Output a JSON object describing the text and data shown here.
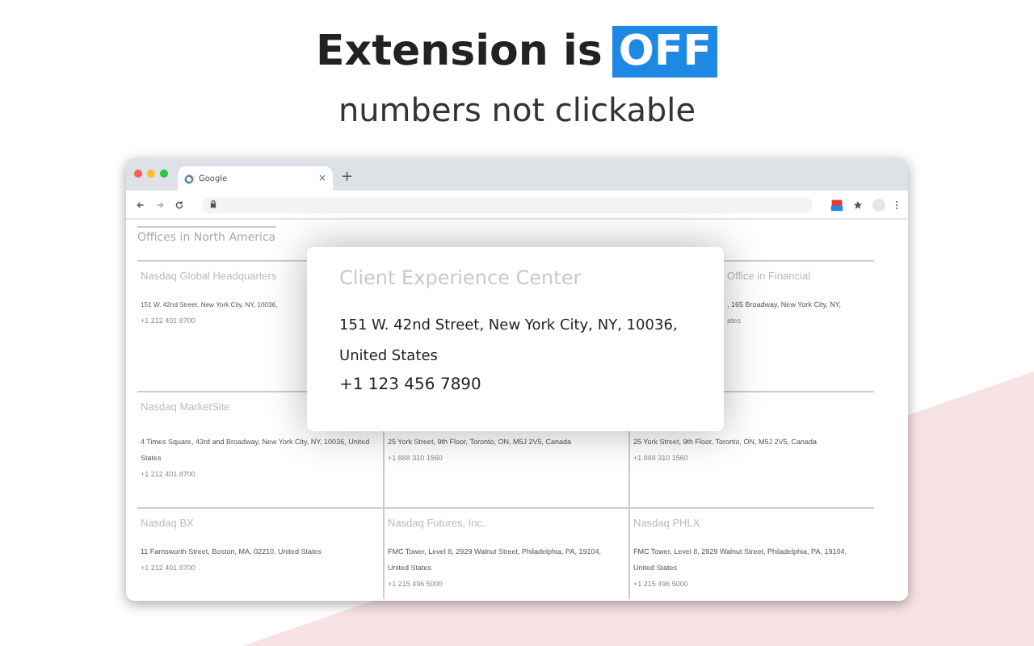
{
  "headline": {
    "text": "Extension is",
    "badge": "OFF"
  },
  "subtitle": "numbers not clickable",
  "browser": {
    "tab_title": "Google",
    "tab_close": "×",
    "new_tab": "+",
    "page": {
      "heading": "Offices in North America",
      "rows": [
        {
          "cards": [
            {
              "title": "Nasdaq Global Headquarters",
              "address": "151 W. 42nd Street, New York City, NY, 10036,",
              "phone": "+1 212 401 8700"
            },
            {
              "title": "Office in Financial",
              "address": ", 165 Broadway, New York City, NY,",
              "phone": "ates"
            }
          ]
        },
        {
          "cards": [
            {
              "title": "Nasdaq MarketSite",
              "address": "4 Times Square, 43rd and Broadway, New York City, NY, 10036, United States",
              "phone": "+1 212 401 8700"
            },
            {
              "address": "25 York Street, 9th Floor, Toronto, ON, M5J 2V5, Canada",
              "phone": "+1 888 310 1560"
            },
            {
              "address": "25 York Street, 9th Floor, Toronto, ON, M5J 2V5, Canada",
              "phone": "+1 888 310 1560"
            }
          ]
        },
        {
          "cards": [
            {
              "title": "Nasdaq BX",
              "address": "11 Farnsworth Street, Boston, MA, 02210, United States",
              "phone": "+1 212 401 8700"
            },
            {
              "title": "Nasdaq Futures, Inc.",
              "address": "FMC Tower, Level 8, 2929 Walnut Street, Philadelphia, PA, 19104, United States",
              "phone": "+1 215 496 5000"
            },
            {
              "title": "Nasdaq PHLX",
              "address": "FMC Tower, Level 8, 2929 Walnut Street, Philadelphia, PA, 19104, United States",
              "phone": "+1 215 496 5000"
            }
          ]
        }
      ]
    },
    "popup": {
      "title": "Client Experience Center",
      "address": "151 W. 42nd Street, New York City, NY, 10036, United States",
      "phone": "+1 123 456 7890"
    }
  }
}
